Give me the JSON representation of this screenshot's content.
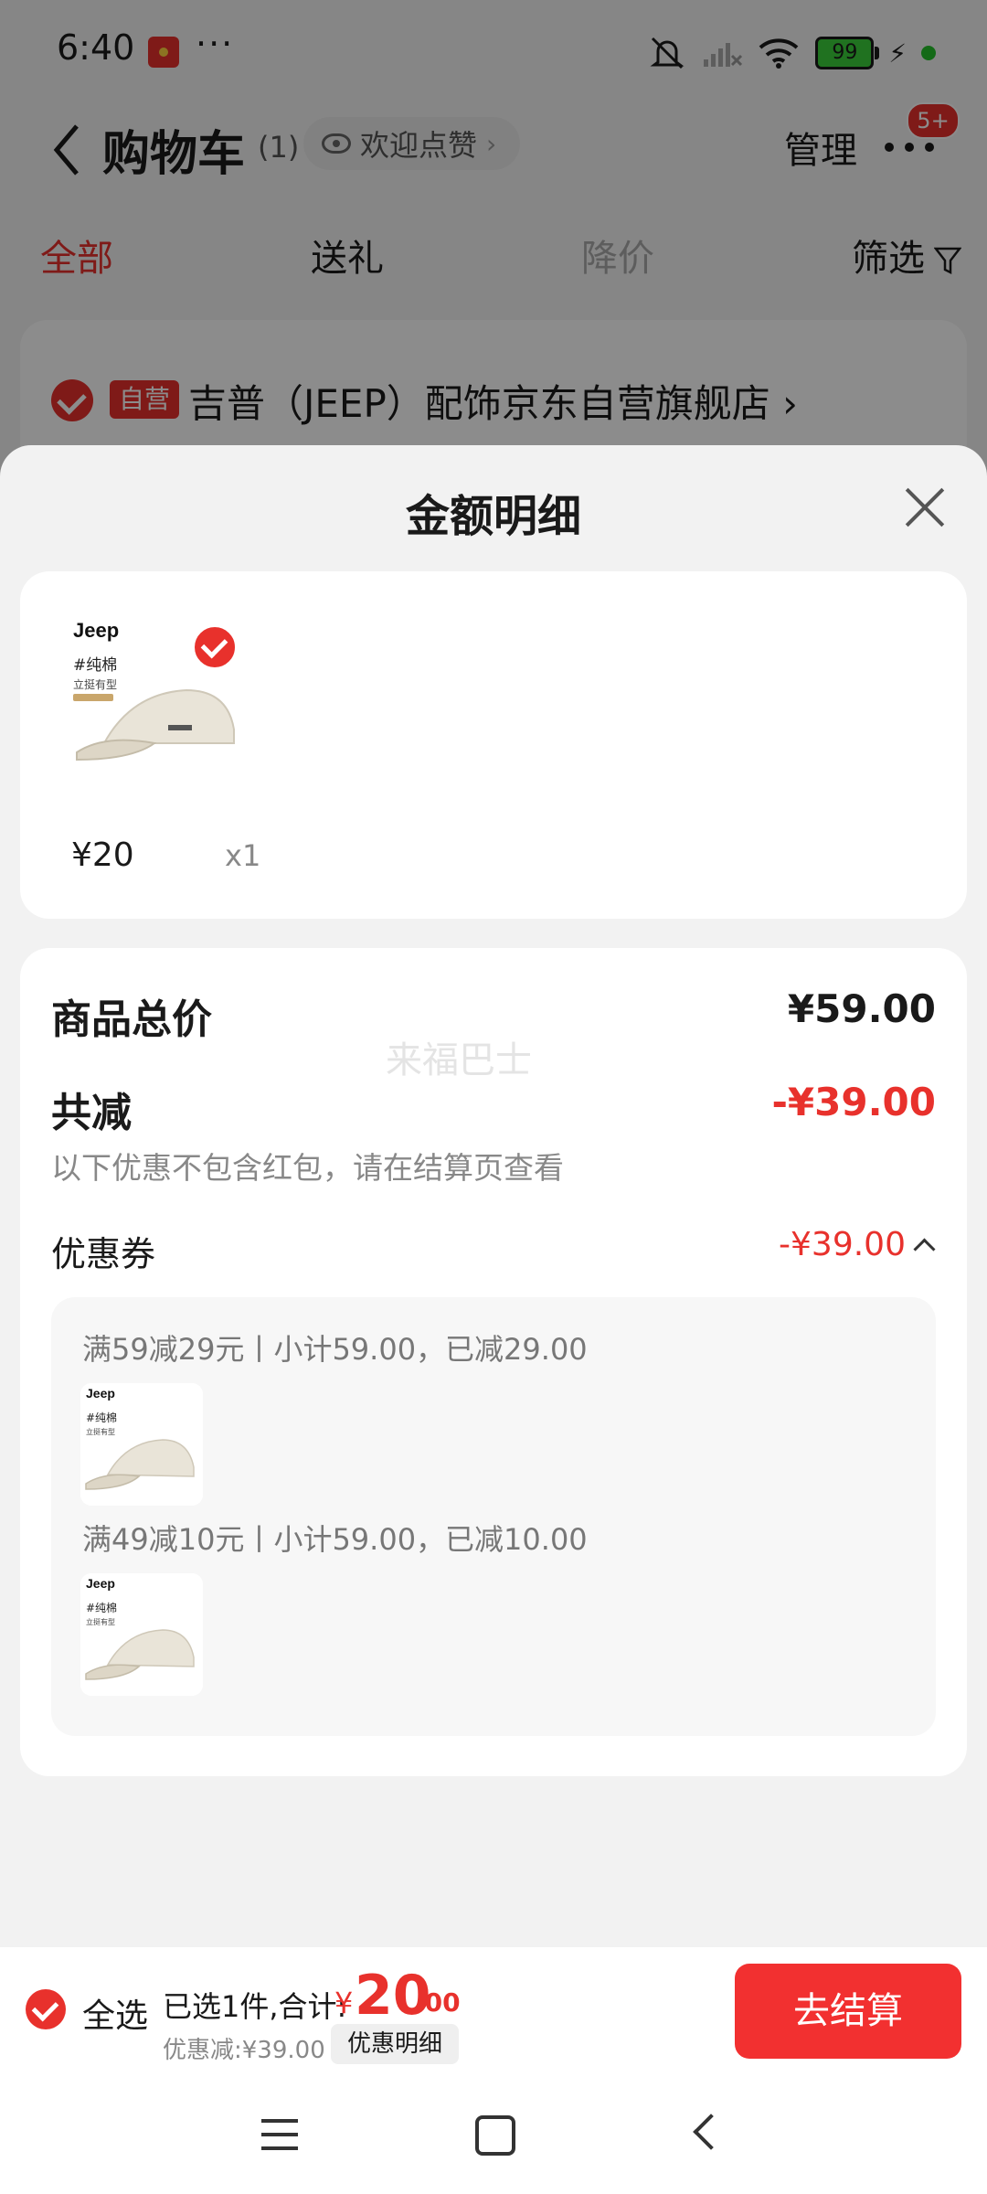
{
  "status_bar": {
    "time": "6:40",
    "dots": "···",
    "battery": "99"
  },
  "header": {
    "title": "购物车",
    "count": "(1)",
    "welcome": "欢迎点赞",
    "manage": "管理",
    "message_badge": "5+"
  },
  "tabs": [
    {
      "label": "全部",
      "state": "active"
    },
    {
      "label": "送礼",
      "state": "normal"
    },
    {
      "label": "降价",
      "state": "disabled"
    },
    {
      "label": "筛选",
      "state": "normal"
    }
  ],
  "store": {
    "badge": "自营",
    "name": "吉普（JEEP）配饰京东自营旗舰店 ›"
  },
  "sheet": {
    "title": "金额明细",
    "goods": {
      "brand": "Jeep",
      "tag1": "#纯棉",
      "tag2": "立挺有型",
      "price": "¥20",
      "qty": "x1"
    },
    "total_label": "商品总价",
    "total_value": "¥59.00",
    "watermark": "来福巴士",
    "reduce_label": "共减",
    "reduce_value": "-¥39.00",
    "note": "以下优惠不包含红包，请在结算页查看",
    "coupon_label": "优惠券",
    "coupon_value": "-¥39.00",
    "coupons": [
      {
        "text": "满59减29元丨小计59.00，已减29.00"
      },
      {
        "text": "满49减10元丨小计59.00，已减10.00"
      }
    ]
  },
  "bottom_bar": {
    "select_all": "全选",
    "selected": "已选1件,合计:",
    "yen": "¥",
    "total_int": "20",
    "total_dec": ".00",
    "discount": "优惠减:¥39.00",
    "detail_btn": "优惠明细",
    "checkout": "去结算"
  },
  "colors": {
    "accent": "#e8312c",
    "checkout": "#f23030"
  }
}
